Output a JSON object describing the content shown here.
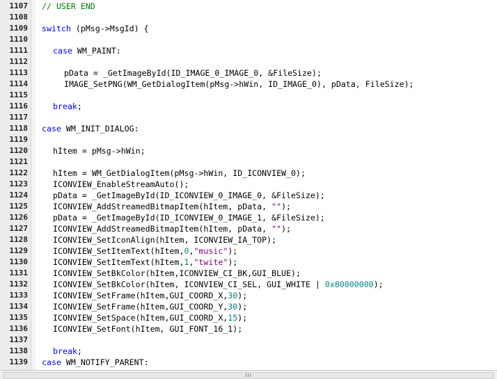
{
  "editor": {
    "lines": [
      {
        "n": "1107",
        "indent": 0,
        "tokens": [
          {
            "t": "// USER END",
            "c": "cmt"
          }
        ]
      },
      {
        "n": "1108",
        "indent": 0,
        "tokens": []
      },
      {
        "n": "1109",
        "indent": 0,
        "tokens": [
          {
            "t": "switch",
            "c": "kw"
          },
          {
            "t": " (pMsg->MsgId) {",
            "c": ""
          }
        ]
      },
      {
        "n": "1110",
        "indent": 0,
        "tokens": []
      },
      {
        "n": "1111",
        "indent": 2,
        "tokens": [
          {
            "t": "case",
            "c": "kw"
          },
          {
            "t": " WM_PAINT:",
            "c": ""
          }
        ]
      },
      {
        "n": "1112",
        "indent": 0,
        "tokens": []
      },
      {
        "n": "1113",
        "indent": 4,
        "tokens": [
          {
            "t": "pData = _GetImageById(ID_IMAGE_0_IMAGE_0, &FileSize);",
            "c": ""
          }
        ]
      },
      {
        "n": "1114",
        "indent": 4,
        "tokens": [
          {
            "t": "IMAGE_SetPNG(WM_GetDialogItem(pMsg->hWin, ID_IMAGE_0), pData, FileSize);",
            "c": ""
          }
        ]
      },
      {
        "n": "1115",
        "indent": 0,
        "tokens": []
      },
      {
        "n": "1116",
        "indent": 2,
        "tokens": [
          {
            "t": "break",
            "c": "kw"
          },
          {
            "t": ";",
            "c": ""
          }
        ]
      },
      {
        "n": "1117",
        "indent": 0,
        "tokens": []
      },
      {
        "n": "1118",
        "indent": 0,
        "tokens": [
          {
            "t": "case",
            "c": "kw"
          },
          {
            "t": " WM_INIT_DIALOG:",
            "c": ""
          }
        ]
      },
      {
        "n": "1119",
        "indent": 0,
        "tokens": []
      },
      {
        "n": "1120",
        "indent": 2,
        "tokens": [
          {
            "t": "hItem = pMsg->hWin;",
            "c": ""
          }
        ]
      },
      {
        "n": "1121",
        "indent": 0,
        "tokens": []
      },
      {
        "n": "1122",
        "indent": 2,
        "tokens": [
          {
            "t": "hItem = WM_GetDialogItem(pMsg->hWin, ID_ICONVIEW_0);",
            "c": ""
          }
        ]
      },
      {
        "n": "1123",
        "indent": 2,
        "tokens": [
          {
            "t": "ICONVIEW_EnableStreamAuto();",
            "c": ""
          }
        ]
      },
      {
        "n": "1124",
        "indent": 2,
        "tokens": [
          {
            "t": "pData = _GetImageById(ID_ICONVIEW_0_IMAGE_0, &FileSize);",
            "c": ""
          }
        ]
      },
      {
        "n": "1125",
        "indent": 2,
        "tokens": [
          {
            "t": "ICONVIEW_AddStreamedBitmapItem(hItem, pData, ",
            "c": ""
          },
          {
            "t": "\"\"",
            "c": "str"
          },
          {
            "t": ");",
            "c": ""
          }
        ]
      },
      {
        "n": "1126",
        "indent": 2,
        "tokens": [
          {
            "t": "pData = _GetImageById(ID_ICONVIEW_0_IMAGE_1, &FileSize);",
            "c": ""
          }
        ]
      },
      {
        "n": "1127",
        "indent": 2,
        "tokens": [
          {
            "t": "ICONVIEW_AddStreamedBitmapItem(hItem, pData, ",
            "c": ""
          },
          {
            "t": "\"\"",
            "c": "str"
          },
          {
            "t": ");",
            "c": ""
          }
        ]
      },
      {
        "n": "1128",
        "indent": 2,
        "tokens": [
          {
            "t": "ICONVIEW_SetIconAlign(hItem, ICONVIEW_IA_TOP);",
            "c": ""
          }
        ]
      },
      {
        "n": "1129",
        "indent": 2,
        "tokens": [
          {
            "t": "ICONVIEW_SetItemText(hItem,",
            "c": ""
          },
          {
            "t": "0",
            "c": "num"
          },
          {
            "t": ",",
            "c": ""
          },
          {
            "t": "\"music\"",
            "c": "str"
          },
          {
            "t": ");",
            "c": ""
          }
        ]
      },
      {
        "n": "1130",
        "indent": 2,
        "tokens": [
          {
            "t": "ICONVIEW_SetItemText(hItem,",
            "c": ""
          },
          {
            "t": "1",
            "c": "num"
          },
          {
            "t": ",",
            "c": ""
          },
          {
            "t": "\"twite\"",
            "c": "str"
          },
          {
            "t": ");",
            "c": ""
          }
        ]
      },
      {
        "n": "1131",
        "indent": 2,
        "tokens": [
          {
            "t": "ICONVIEW_SetBkColor(hItem,ICONVIEW_CI_BK,GUI_BLUE);",
            "c": ""
          }
        ]
      },
      {
        "n": "1132",
        "indent": 2,
        "tokens": [
          {
            "t": "ICONVIEW_SetBkColor(hItem, ICONVIEW_CI_SEL, GUI_WHITE | ",
            "c": ""
          },
          {
            "t": "0x80000000",
            "c": "num"
          },
          {
            "t": ");",
            "c": ""
          }
        ]
      },
      {
        "n": "1133",
        "indent": 2,
        "tokens": [
          {
            "t": "ICONVIEW_SetFrame(hItem,GUI_COORD_X,",
            "c": ""
          },
          {
            "t": "30",
            "c": "num"
          },
          {
            "t": ");",
            "c": ""
          }
        ]
      },
      {
        "n": "1134",
        "indent": 2,
        "tokens": [
          {
            "t": "ICONVIEW_SetFrame(hItem,GUI_COORD_Y,",
            "c": ""
          },
          {
            "t": "30",
            "c": "num"
          },
          {
            "t": ");",
            "c": ""
          }
        ]
      },
      {
        "n": "1135",
        "indent": 2,
        "tokens": [
          {
            "t": "ICONVIEW_SetSpace(hItem,GUI_COORD_X,",
            "c": ""
          },
          {
            "t": "15",
            "c": "num"
          },
          {
            "t": ");",
            "c": ""
          }
        ]
      },
      {
        "n": "1136",
        "indent": 2,
        "tokens": [
          {
            "t": "ICONVIEW_SetFont(hItem, GUI_FONT_16_1);",
            "c": ""
          }
        ]
      },
      {
        "n": "1137",
        "indent": 0,
        "tokens": []
      },
      {
        "n": "1138",
        "indent": 2,
        "tokens": [
          {
            "t": "break",
            "c": "kw"
          },
          {
            "t": ";",
            "c": ""
          }
        ]
      },
      {
        "n": "1139",
        "indent": 0,
        "tokens": [
          {
            "t": "case",
            "c": "kw"
          },
          {
            "t": " WM_NOTIFY_PARENT:",
            "c": ""
          }
        ]
      }
    ]
  },
  "scrollbar": {
    "grip": "III"
  },
  "colors": {
    "keyword": "#0000ff",
    "comment": "#008000",
    "string": "#800080",
    "number": "#008080",
    "line_number": "#222222"
  }
}
